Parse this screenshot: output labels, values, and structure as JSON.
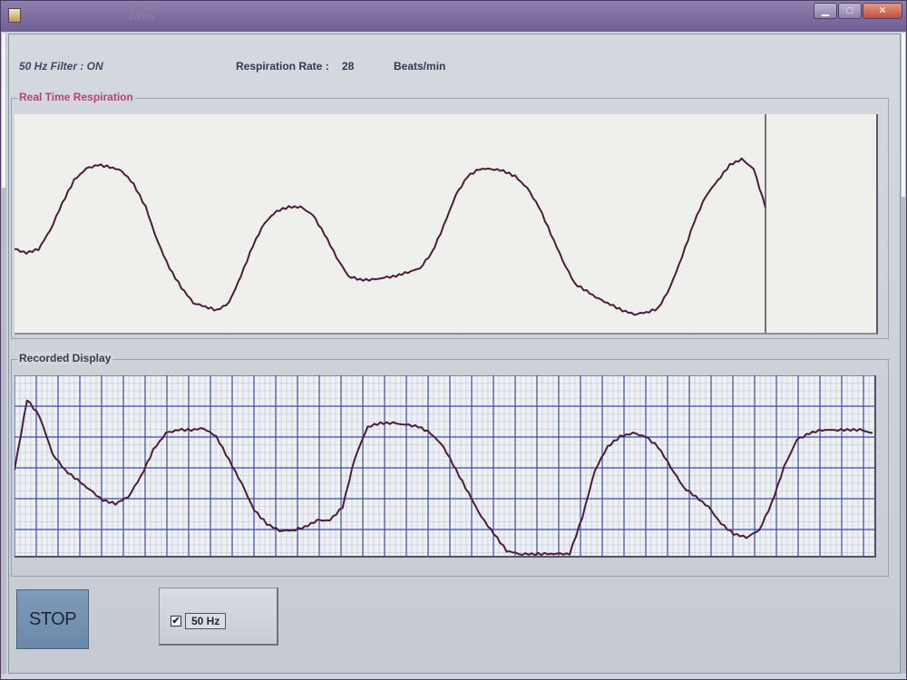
{
  "window": {
    "title": "Java"
  },
  "status": {
    "filter_text": "50 Hz Filter :  ON",
    "resp_rate_label": "Respiration Rate :",
    "resp_rate_value": "28",
    "resp_rate_unit": "Beats/min"
  },
  "panels": {
    "realtime_title": "Real Time Respiration",
    "recorded_title": "Recorded Display"
  },
  "controls": {
    "stop_label": "STOP",
    "filter_checkbox_label": "50 Hz",
    "filter_checked": true
  },
  "colors": {
    "trace": "#4b1d3a",
    "grid_major": "#3b4aa8",
    "grid_minor": "#b8bfd8",
    "accent_title": "#b8446c"
  },
  "chart_data": [
    {
      "type": "line",
      "name": "Real Time Respiration",
      "x": [
        0,
        2,
        4,
        6,
        8,
        10,
        12,
        14,
        16,
        18,
        20,
        22,
        24,
        26,
        28,
        30,
        32,
        34,
        36,
        38,
        40,
        42,
        44,
        46,
        48,
        50,
        52,
        54,
        56,
        58,
        60,
        62,
        64,
        66,
        68,
        70,
        72,
        74,
        76,
        78,
        80,
        82,
        84,
        86,
        88,
        90,
        92,
        94,
        96,
        98,
        100,
        102,
        104,
        106,
        108,
        110,
        112,
        114,
        116,
        118,
        120,
        122,
        124,
        126,
        128,
        130,
        132,
        134,
        136,
        138,
        140,
        142,
        144,
        146,
        148,
        150,
        152,
        154,
        156,
        158,
        160,
        162,
        164,
        166,
        168,
        170,
        172,
        174,
        176,
        178,
        180,
        182,
        184,
        186,
        188,
        190,
        192,
        194,
        196,
        198,
        200,
        202,
        204,
        206,
        208,
        210
      ],
      "y": [
        0.38,
        0.36,
        0.38,
        0.48,
        0.62,
        0.74,
        0.8,
        0.82,
        0.81,
        0.79,
        0.72,
        0.6,
        0.42,
        0.28,
        0.18,
        0.1,
        0.08,
        0.06,
        0.1,
        0.24,
        0.4,
        0.52,
        0.58,
        0.6,
        0.6,
        0.56,
        0.46,
        0.34,
        0.24,
        0.22,
        0.22,
        0.23,
        0.24,
        0.26,
        0.28,
        0.36,
        0.5,
        0.66,
        0.76,
        0.8,
        0.8,
        0.79,
        0.76,
        0.7,
        0.6,
        0.46,
        0.32,
        0.2,
        0.16,
        0.12,
        0.09,
        0.06,
        0.04,
        0.05,
        0.07,
        0.18,
        0.34,
        0.52,
        0.66,
        0.74,
        0.82,
        0.85,
        0.8,
        0.6
      ]
    },
    {
      "type": "line",
      "name": "Recorded Display",
      "x": [
        0,
        2,
        4,
        6,
        8,
        10,
        12,
        14,
        16,
        18,
        20,
        22,
        24,
        26,
        28,
        30,
        32,
        34,
        36,
        38,
        40,
        42,
        44,
        46,
        48,
        50,
        52,
        54,
        56,
        58,
        60,
        62,
        64,
        66,
        68,
        70,
        72,
        74,
        76,
        78,
        80,
        82,
        84,
        86,
        88,
        90,
        92,
        94,
        96,
        98,
        100,
        102,
        104,
        106,
        108,
        110,
        112,
        114,
        116,
        118,
        120,
        122,
        124,
        126,
        128,
        130,
        132,
        134,
        136,
        138,
        140,
        142,
        144,
        146,
        148,
        150,
        152,
        154,
        156,
        158,
        160,
        162,
        164,
        166,
        168,
        170,
        172,
        174,
        176,
        178,
        180,
        182,
        184,
        186,
        188,
        190,
        192,
        194,
        196,
        198,
        200
      ],
      "y": [
        0.5,
        0.92,
        0.82,
        0.6,
        0.5,
        0.44,
        0.38,
        0.32,
        0.3,
        0.34,
        0.46,
        0.62,
        0.72,
        0.74,
        0.74,
        0.75,
        0.7,
        0.56,
        0.42,
        0.26,
        0.18,
        0.14,
        0.14,
        0.16,
        0.2,
        0.2,
        0.28,
        0.58,
        0.76,
        0.78,
        0.78,
        0.77,
        0.76,
        0.72,
        0.64,
        0.5,
        0.36,
        0.22,
        0.12,
        0.02,
        0.0,
        0.0,
        0.0,
        0.0,
        0.0,
        0.22,
        0.5,
        0.64,
        0.7,
        0.72,
        0.7,
        0.64,
        0.52,
        0.4,
        0.34,
        0.28,
        0.18,
        0.12,
        0.1,
        0.14,
        0.3,
        0.52,
        0.68,
        0.72,
        0.74,
        0.74,
        0.74,
        0.74,
        0.72
      ]
    }
  ]
}
